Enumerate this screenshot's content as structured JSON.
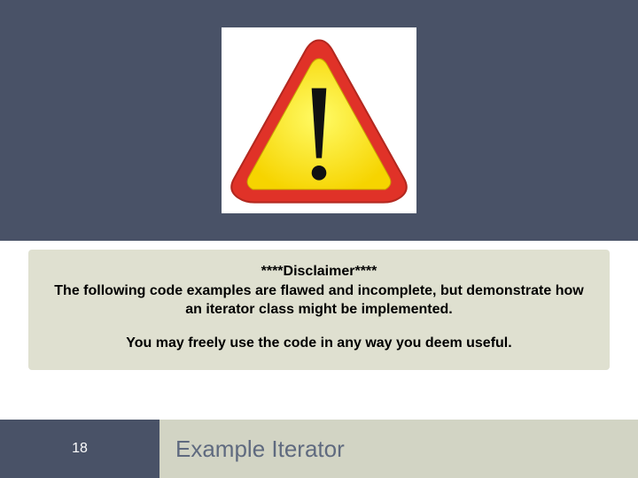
{
  "disclaimer": {
    "heading": "****Disclaimer****",
    "line1": "The following code examples are flawed and incomplete, but demonstrate how an iterator class might be implemented.",
    "line2": "You may freely use the code in any way you deem useful."
  },
  "footer": {
    "page_number": "18",
    "title": "Example Iterator"
  },
  "icon": {
    "name": "warning-triangle-icon"
  }
}
